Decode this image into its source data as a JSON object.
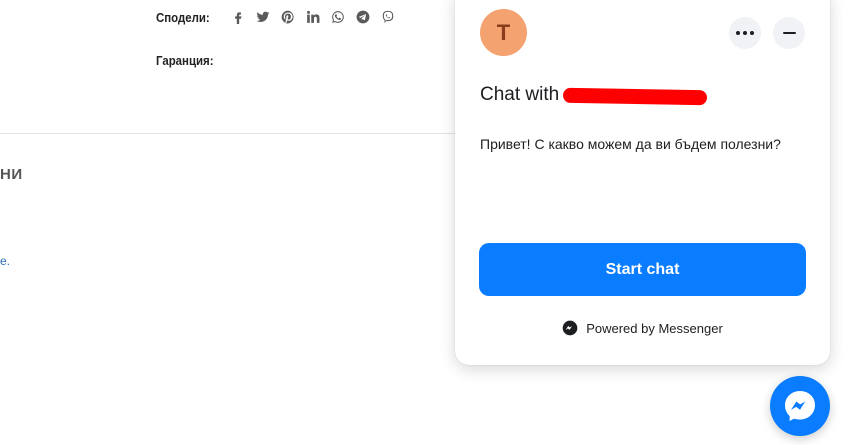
{
  "page": {
    "share_label": "Сподели:",
    "share_icons": [
      "facebook-icon",
      "twitter-icon",
      "pinterest-icon",
      "linkedin-icon",
      "whatsapp-icon",
      "telegram-icon",
      "viber-icon"
    ],
    "warranty_label": "Гаранция:",
    "cut_heading": "НИ",
    "cut_text": "е."
  },
  "chat": {
    "avatar_letter": "T",
    "title_prefix": "Chat with",
    "greeting": "Привет! С какво можем да ви бъдем полезни?",
    "start_button": "Start chat",
    "powered_by": "Powered by Messenger",
    "colors": {
      "accent": "#0a7cff",
      "avatar_bg": "#f4a26f",
      "redaction": "#ff0000"
    }
  }
}
